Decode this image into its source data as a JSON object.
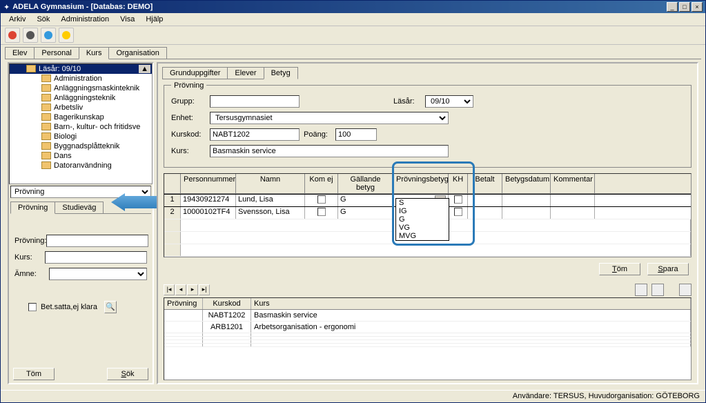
{
  "title": "ADELA Gymnasium - [Databas: DEMO]",
  "menu": [
    "Arkiv",
    "Sök",
    "Administration",
    "Visa",
    "Hjälp"
  ],
  "main_tabs": [
    "Elev",
    "Personal",
    "Kurs",
    "Organisation"
  ],
  "main_tab_active": 2,
  "tree": {
    "root": "Läsår: 09/10",
    "items": [
      "Administration",
      "Anläggningsmaskinteknik",
      "Anläggningsteknik",
      "Arbetsliv",
      "Bagerikunskap",
      "Barn-, kultur- och fritidsve",
      "Biologi",
      "Byggnadsplåtteknik",
      "Dans",
      "Datoranvändning"
    ]
  },
  "left_dropdown": "Prövning",
  "left_sub_tabs": [
    "Prövning",
    "Studieväg"
  ],
  "left_form": {
    "provning": "Prövning:",
    "kurs": "Kurs:",
    "amne": "Ämne:",
    "bet_chk": "Bet.satta,ej klara"
  },
  "left_buttons": {
    "tom": "Töm",
    "sok": "Sök"
  },
  "right_tabs": [
    "Grunduppgifter",
    "Elever",
    "Betyg"
  ],
  "right_tab_active": 2,
  "fieldset": {
    "legend": "Prövning",
    "grupp": "Grupp:",
    "lasar": "Läsår:",
    "lasar_val": "09/10",
    "enhet": "Enhet:",
    "enhet_val": "Tersusgymnasiet",
    "kurskod": "Kurskod:",
    "kurskod_val": "NABT1202",
    "poang": "Poäng:",
    "poang_val": "100",
    "kurs": "Kurs:",
    "kurs_val": "Basmaskin service"
  },
  "grid": {
    "headers": [
      "Personnummer",
      "Namn",
      "Kom ej",
      "Gällande betyg",
      "Prövningsbetyg",
      "KH",
      "Betalt",
      "Betygsdatum",
      "Kommentar"
    ],
    "rows": [
      {
        "idx": "1",
        "pnr": "19430921274",
        "namn": "Lund, Lisa",
        "betyg": "G"
      },
      {
        "idx": "2",
        "pnr": "10000102TF4",
        "namn": "Svensson, Lisa",
        "betyg": "G"
      }
    ],
    "dropdown_options": [
      "S",
      "IG",
      "G",
      "VG",
      "MVG"
    ]
  },
  "action_buttons": {
    "tom": "Töm",
    "spara": "Spara"
  },
  "lower_grid": {
    "headers": [
      "Prövning",
      "Kurskod",
      "Kurs"
    ],
    "rows": [
      {
        "kod": "NABT1202",
        "kurs": "Basmaskin service",
        "sel": true
      },
      {
        "kod": "ARB1201",
        "kurs": "Arbetsorganisation - ergonomi",
        "sel": false
      }
    ]
  },
  "status": "Användare: TERSUS, Huvudorganisation: GÖTEBORG"
}
